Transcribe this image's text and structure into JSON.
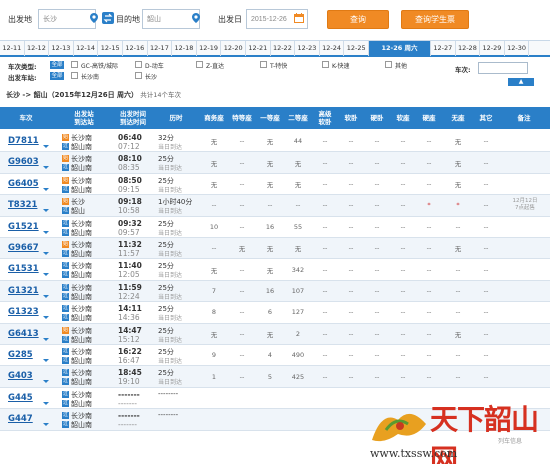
{
  "search": {
    "from_label": "出发地",
    "from_value": "长沙",
    "to_label": "目的地",
    "to_value": "韶山",
    "date_label": "出发日",
    "date_value": "2015-12-26",
    "query_button": "查询",
    "student_button": "查询学生票"
  },
  "date_tabs": [
    "12-11",
    "12-12",
    "12-13",
    "12-14",
    "12-15",
    "12-16",
    "12-17",
    "12-18",
    "12-19",
    "12-20",
    "12-21",
    "12-22",
    "12-23",
    "12-24",
    "12-25",
    "12-26 周六",
    "12-27",
    "12-28",
    "12-29",
    "12-30"
  ],
  "filters": {
    "type_label": "车次类型:",
    "all_label": "全部",
    "types": [
      "GC-高铁/城际",
      "D-动车",
      "Z-直达",
      "T-特快",
      "K-快速",
      "其他"
    ],
    "station_label": "出发车站:",
    "stations": [
      "长沙南",
      "长沙"
    ],
    "arrival_label": "车次:",
    "collapse": "▲"
  },
  "summary": {
    "route": "长沙 -> 韶山（2015年12月26日  周六）",
    "count": "共计14个车次"
  },
  "headers": {
    "train": "车次",
    "stations": "出发站\n到达站",
    "times": "出发时间\n到达时间",
    "duration": "历时",
    "business": "商务座",
    "special": "特等座",
    "first": "一等座",
    "second": "二等座",
    "soft_sleeper_hi": "高级\n软卧",
    "soft_sleeper": "软卧",
    "hard_sleeper": "硬卧",
    "soft_seat": "软座",
    "hard_seat": "硬座",
    "no_seat": "无座",
    "other": "其它",
    "remark": "备注"
  },
  "rows": [
    {
      "train": "D7811",
      "from": "长沙南",
      "to": "韶山南",
      "dep": "06:40",
      "arr": "07:12",
      "dur": "32分",
      "dur2": "当日到达",
      "from_type": "start",
      "seats": [
        "无",
        "--",
        "无",
        "44",
        "--",
        "--",
        "--",
        "--",
        "--",
        "无",
        "--"
      ],
      "remark": ""
    },
    {
      "train": "G9603",
      "from": "长沙南",
      "to": "韶山南",
      "dep": "08:10",
      "arr": "08:35",
      "dur": "25分",
      "dur2": "当日到达",
      "from_type": "start",
      "seats": [
        "无",
        "--",
        "无",
        "无",
        "--",
        "--",
        "--",
        "--",
        "--",
        "无",
        "--"
      ],
      "remark": ""
    },
    {
      "train": "G6405",
      "from": "长沙南",
      "to": "韶山南",
      "dep": "08:50",
      "arr": "09:15",
      "dur": "25分",
      "dur2": "当日到达",
      "from_type": "start",
      "seats": [
        "无",
        "--",
        "无",
        "无",
        "--",
        "--",
        "--",
        "--",
        "--",
        "无",
        "--"
      ],
      "remark": ""
    },
    {
      "train": "T8321",
      "from": "长沙",
      "to": "韶山",
      "dep": "09:18",
      "arr": "10:58",
      "dur": "1小时40分",
      "dur2": "当日到达",
      "from_type": "start",
      "seats": [
        "--",
        "--",
        "--",
        "--",
        "--",
        "--",
        "--",
        "--",
        "*",
        "*",
        "--"
      ],
      "remark": "12月12日\n7点起售"
    },
    {
      "train": "G1521",
      "from": "长沙南",
      "to": "韶山南",
      "dep": "09:32",
      "arr": "09:57",
      "dur": "25分",
      "dur2": "当日到达",
      "from_type": "pass",
      "seats": [
        "10",
        "--",
        "16",
        "55",
        "--",
        "--",
        "--",
        "--",
        "--",
        "--",
        "--"
      ],
      "remark": ""
    },
    {
      "train": "G9667",
      "from": "长沙南",
      "to": "韶山南",
      "dep": "11:32",
      "arr": "11:57",
      "dur": "25分",
      "dur2": "当日到达",
      "from_type": "start",
      "seats": [
        "--",
        "无",
        "无",
        "无",
        "--",
        "--",
        "--",
        "--",
        "--",
        "无",
        "--"
      ],
      "remark": ""
    },
    {
      "train": "G1531",
      "from": "长沙南",
      "to": "韶山南",
      "dep": "11:40",
      "arr": "12:05",
      "dur": "25分",
      "dur2": "当日到达",
      "from_type": "pass",
      "seats": [
        "无",
        "--",
        "无",
        "342",
        "--",
        "--",
        "--",
        "--",
        "--",
        "--",
        "--"
      ],
      "remark": ""
    },
    {
      "train": "G1321",
      "from": "长沙南",
      "to": "韶山南",
      "dep": "11:59",
      "arr": "12:24",
      "dur": "25分",
      "dur2": "当日到达",
      "from_type": "pass",
      "seats": [
        "7",
        "--",
        "16",
        "107",
        "--",
        "--",
        "--",
        "--",
        "--",
        "--",
        "--"
      ],
      "remark": ""
    },
    {
      "train": "G1323",
      "from": "长沙南",
      "to": "韶山南",
      "dep": "14:11",
      "arr": "14:36",
      "dur": "25分",
      "dur2": "当日到达",
      "from_type": "pass",
      "seats": [
        "8",
        "--",
        "6",
        "127",
        "--",
        "--",
        "--",
        "--",
        "--",
        "--",
        "--"
      ],
      "remark": ""
    },
    {
      "train": "G6413",
      "from": "长沙南",
      "to": "韶山南",
      "dep": "14:47",
      "arr": "15:12",
      "dur": "25分",
      "dur2": "当日到达",
      "from_type": "start",
      "seats": [
        "无",
        "--",
        "无",
        "2",
        "--",
        "--",
        "--",
        "--",
        "--",
        "无",
        "--"
      ],
      "remark": ""
    },
    {
      "train": "G285",
      "from": "长沙南",
      "to": "韶山南",
      "dep": "16:22",
      "arr": "16:47",
      "dur": "25分",
      "dur2": "当日到达",
      "from_type": "pass",
      "seats": [
        "9",
        "--",
        "4",
        "490",
        "--",
        "--",
        "--",
        "--",
        "--",
        "--",
        "--"
      ],
      "remark": ""
    },
    {
      "train": "G403",
      "from": "长沙南",
      "to": "韶山南",
      "dep": "18:45",
      "arr": "19:10",
      "dur": "25分",
      "dur2": "当日到达",
      "from_type": "pass",
      "seats": [
        "1",
        "--",
        "5",
        "425",
        "--",
        "--",
        "--",
        "--",
        "--",
        "--",
        "--"
      ],
      "remark": ""
    },
    {
      "train": "G445",
      "from": "长沙南",
      "to": "韶山南",
      "dep": "-------",
      "arr": "-------",
      "dur": "--------",
      "dur2": "",
      "from_type": "pass",
      "seats": [
        "",
        "",
        "",
        "",
        "",
        "",
        "",
        "",
        "",
        "",
        ""
      ],
      "remark": ""
    },
    {
      "train": "G447",
      "from": "长沙南",
      "to": "韶山南",
      "dep": "-------",
      "arr": "-------",
      "dur": "--------",
      "dur2": "",
      "from_type": "pass",
      "seats": [
        "",
        "",
        "",
        "",
        "",
        "",
        "",
        "",
        "",
        "",
        ""
      ],
      "remark": ""
    }
  ],
  "watermark": {
    "title": "天下韶山网",
    "sub": "列车信息",
    "url": "www.txssw.com"
  }
}
